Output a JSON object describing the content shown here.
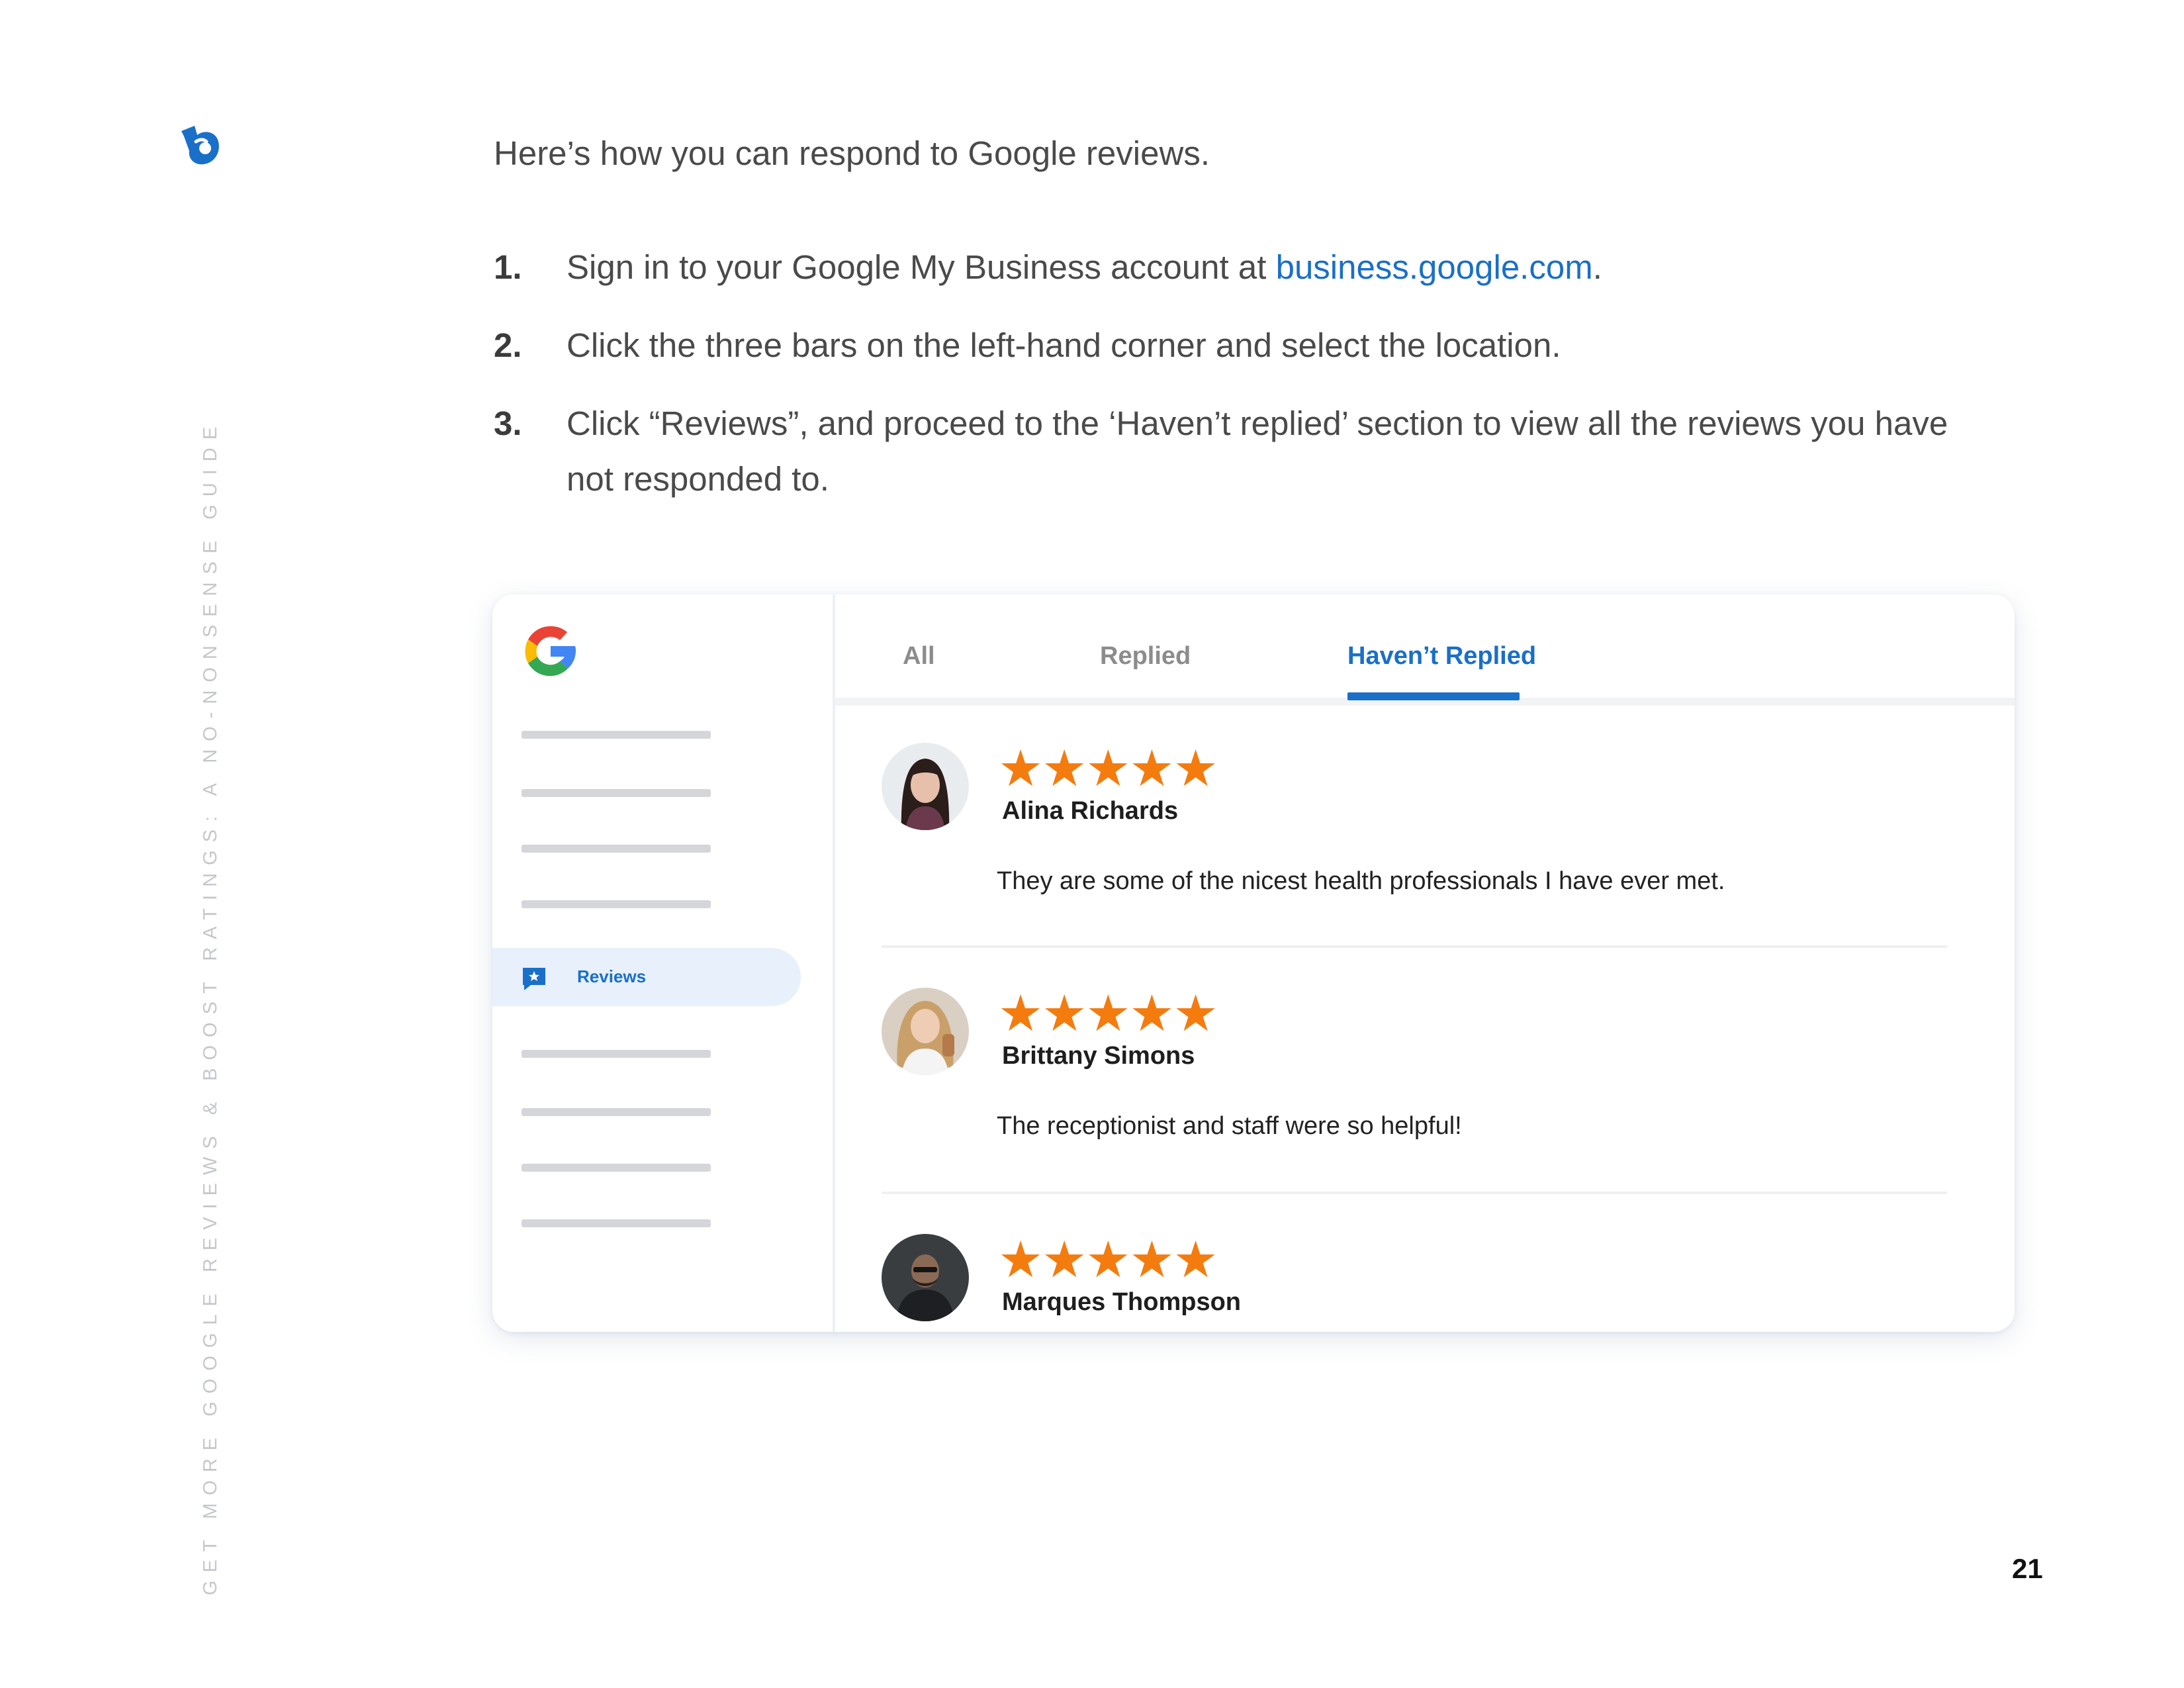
{
  "side_title": "GET MORE GOOGLE REVIEWS & BOOST RATINGS: A NO-NONSENSE GUIDE",
  "intro": "Here’s how you can respond to Google reviews.",
  "steps": [
    {
      "num": "1.",
      "text_before": "Sign in to your Google My Business account at ",
      "link": "business.google.com",
      "text_after": "."
    },
    {
      "num": "2.",
      "text": "Click the three bars on the left-hand corner and select the location."
    },
    {
      "num": "3.",
      "text": "Click “Reviews”, and proceed to the ‘Haven’t replied’ section to view all the reviews you have not responded to."
    }
  ],
  "mock": {
    "sidebar": {
      "active_item": "Reviews"
    },
    "tabs": [
      "All",
      "Replied",
      "Haven’t Replied"
    ],
    "active_tab": "Haven’t Replied",
    "reviews": [
      {
        "stars": "★★★★★",
        "rating": 5,
        "name": "Alina Richards",
        "text": "They are some of the nicest health professionals I have ever met."
      },
      {
        "stars": "★★★★★",
        "rating": 5,
        "name": "Brittany Simons",
        "text": "The receptionist and staff were so helpful!"
      },
      {
        "stars": "★★★★★",
        "rating": 5,
        "name": "Marques Thompson",
        "text": ""
      }
    ]
  },
  "page_number": "21",
  "colors": {
    "link": "#1a6fc8",
    "star": "#f47b0e",
    "active_bg": "#e8f0fc"
  }
}
